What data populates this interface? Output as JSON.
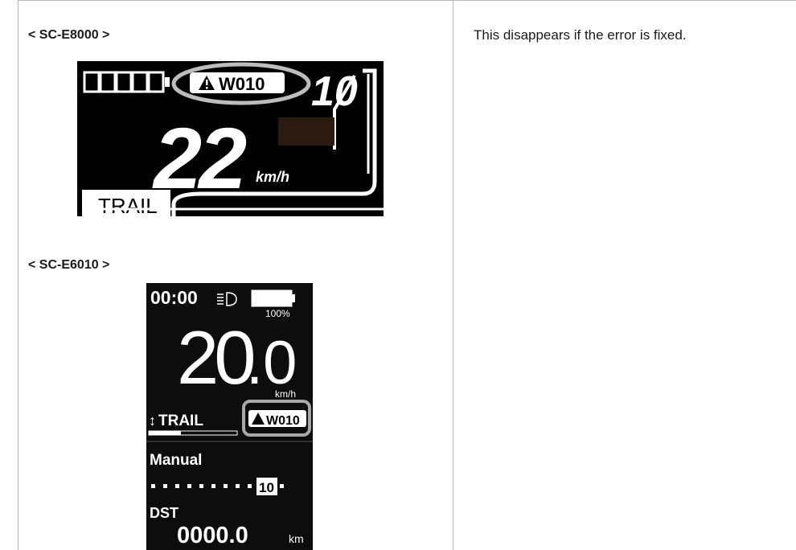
{
  "models": {
    "first": "< SC-E8000 >",
    "second": "< SC-E6010 >"
  },
  "description": "This disappears if the error is fixed.",
  "display_e8000": {
    "warning_code": "W010",
    "assist_level": "10",
    "speed": "22",
    "unit": "km/h",
    "mode": "TRAIL"
  },
  "display_e6010": {
    "time": "00:00",
    "battery": "100%",
    "speed_int": "20",
    "speed_dec": ".0",
    "unit": "km/h",
    "mode": "TRAIL",
    "warning_code": "W010",
    "shift_mode": "Manual",
    "gear": "10",
    "distance_label": "DST",
    "distance_value": "0000.0",
    "distance_unit": "km"
  }
}
